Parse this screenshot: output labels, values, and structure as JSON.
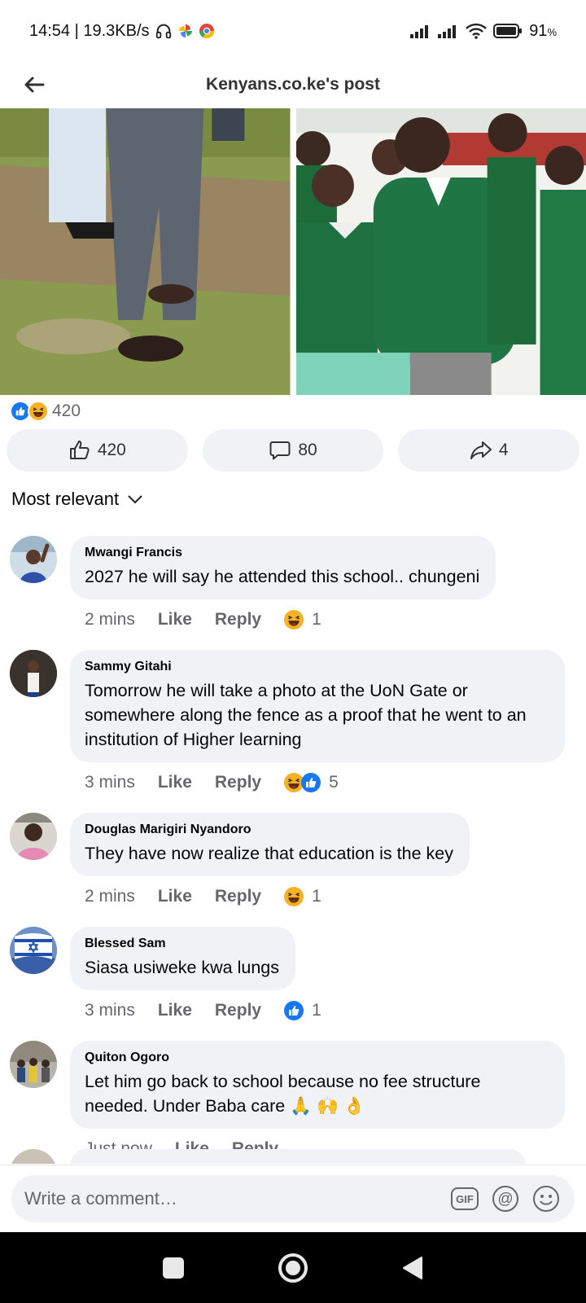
{
  "status_bar": {
    "time_speed": "14:54 | 19.3KB/s",
    "battery": "91",
    "battery_unit": "%"
  },
  "header": {
    "title": "Kenyans.co.ke's post"
  },
  "post": {
    "reaction_count": "420",
    "actions": {
      "like_count": "420",
      "comment_count": "80",
      "share_count": "4"
    }
  },
  "sort": {
    "label": "Most relevant"
  },
  "comments": [
    {
      "author": "Mwangi Francis",
      "text": "2027 he will say he attended this school.. chungeni",
      "time": "2 mins",
      "like": "Like",
      "reply": "Reply",
      "reaction_count": "1",
      "reactions": [
        "haha"
      ]
    },
    {
      "author": "Sammy Gitahi",
      "text": "Tomorrow he will take a photo at the UoN Gate or somewhere along the fence as a proof that he went to an institution of Higher learning",
      "time": "3 mins",
      "like": "Like",
      "reply": "Reply",
      "reaction_count": "5",
      "reactions": [
        "haha",
        "like"
      ]
    },
    {
      "author": "Douglas Marigiri Nyandoro",
      "text": "They have now realize that education is the key",
      "time": "2 mins",
      "like": "Like",
      "reply": "Reply",
      "reaction_count": "1",
      "reactions": [
        "haha"
      ]
    },
    {
      "author": "Blessed Sam",
      "text": "Siasa usiweke kwa lungs",
      "time": "3 mins",
      "like": "Like",
      "reply": "Reply",
      "reaction_count": "1",
      "reactions": [
        "like"
      ]
    },
    {
      "author": "Quiton Ogoro",
      "text": "Let him go back to school because no fee structure needed. Under Baba care 🙏 🙌 👌",
      "time": "Just now",
      "like": "Like",
      "reply": "Reply",
      "reaction_count": "",
      "reactions": []
    }
  ],
  "composer": {
    "placeholder": "Write a comment…"
  },
  "colors": {
    "like_blue": "#1877f2",
    "haha_yellow": "#f7b125",
    "bubble_grey": "#f0f2f5",
    "meta_grey": "#65676b"
  }
}
